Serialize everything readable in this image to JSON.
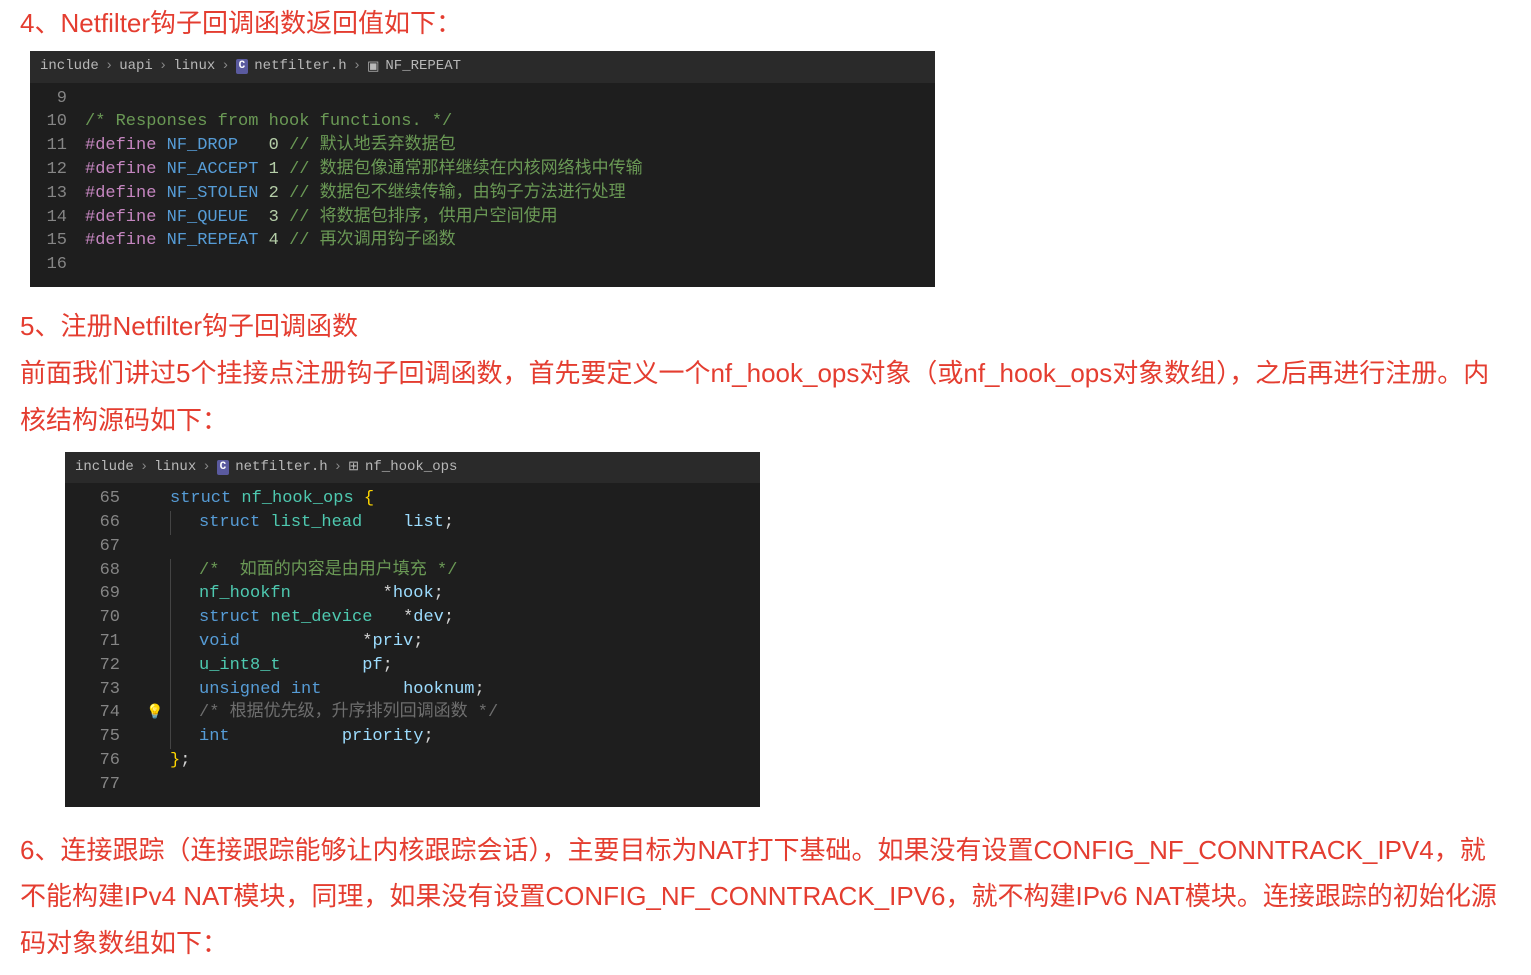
{
  "section4": {
    "title": "4、Netfilter钩子回调函数返回值如下：",
    "breadcrumb": {
      "p1": "include",
      "p2": "uapi",
      "p3": "linux",
      "file": "netfilter.h",
      "symbol": "NF_REPEAT"
    },
    "lines": [
      {
        "num": "9",
        "tokens": []
      },
      {
        "num": "10",
        "tokens": [
          {
            "t": "/* Responses from hook functions. */",
            "c": "c-comment"
          }
        ]
      },
      {
        "num": "11",
        "tokens": [
          {
            "t": "#define",
            "c": "c-keyword"
          },
          {
            "t": " ",
            "c": ""
          },
          {
            "t": "NF_DROP",
            "c": "c-macro"
          },
          {
            "t": "   ",
            "c": ""
          },
          {
            "t": "0",
            "c": "c-number"
          },
          {
            "t": " ",
            "c": ""
          },
          {
            "t": "// 默认地丢弃数据包",
            "c": "c-comment"
          }
        ]
      },
      {
        "num": "12",
        "tokens": [
          {
            "t": "#define",
            "c": "c-keyword"
          },
          {
            "t": " ",
            "c": ""
          },
          {
            "t": "NF_ACCEPT",
            "c": "c-macro"
          },
          {
            "t": " ",
            "c": ""
          },
          {
            "t": "1",
            "c": "c-number"
          },
          {
            "t": " ",
            "c": ""
          },
          {
            "t": "// 数据包像通常那样继续在内核网络栈中传输",
            "c": "c-comment"
          }
        ]
      },
      {
        "num": "13",
        "tokens": [
          {
            "t": "#define",
            "c": "c-keyword"
          },
          {
            "t": " ",
            "c": ""
          },
          {
            "t": "NF_STOLEN",
            "c": "c-macro"
          },
          {
            "t": " ",
            "c": ""
          },
          {
            "t": "2",
            "c": "c-number"
          },
          {
            "t": " ",
            "c": ""
          },
          {
            "t": "// 数据包不继续传输，由钩子方法进行处理",
            "c": "c-comment"
          }
        ]
      },
      {
        "num": "14",
        "tokens": [
          {
            "t": "#define",
            "c": "c-keyword"
          },
          {
            "t": " ",
            "c": ""
          },
          {
            "t": "NF_QUEUE",
            "c": "c-macro"
          },
          {
            "t": "  ",
            "c": ""
          },
          {
            "t": "3",
            "c": "c-number"
          },
          {
            "t": " ",
            "c": ""
          },
          {
            "t": "// 将数据包排序，供用户空间使用",
            "c": "c-comment"
          }
        ]
      },
      {
        "num": "15",
        "tokens": [
          {
            "t": "#define",
            "c": "c-keyword"
          },
          {
            "t": " ",
            "c": ""
          },
          {
            "t": "NF_REPEAT",
            "c": "c-macro"
          },
          {
            "t": " ",
            "c": ""
          },
          {
            "t": "4",
            "c": "c-number"
          },
          {
            "t": " ",
            "c": ""
          },
          {
            "t": "// 再次调用钩子函数",
            "c": "c-comment"
          }
        ]
      },
      {
        "num": "16",
        "tokens": []
      }
    ]
  },
  "section5": {
    "title": "5、注册Netfilter钩子回调函数",
    "para": "前面我们讲过5个挂接点注册钩子回调函数，首先要定义一个nf_hook_ops对象（或nf_hook_ops对象数组），之后再进行注册。内核结构源码如下：",
    "breadcrumb": {
      "p1": "include",
      "p2": "linux",
      "file": "netfilter.h",
      "symbol": "nf_hook_ops"
    },
    "lines": [
      {
        "num": "65",
        "indent": false,
        "bulb": false,
        "tokens": [
          {
            "t": "struct",
            "c": "c-struct-kw"
          },
          {
            "t": " ",
            "c": ""
          },
          {
            "t": "nf_hook_ops",
            "c": "c-type"
          },
          {
            "t": " ",
            "c": ""
          },
          {
            "t": "{",
            "c": "c-brace"
          }
        ]
      },
      {
        "num": "66",
        "indent": true,
        "bulb": false,
        "tokens": [
          {
            "t": "struct",
            "c": "c-struct-kw"
          },
          {
            "t": " ",
            "c": ""
          },
          {
            "t": "list_head",
            "c": "c-type"
          },
          {
            "t": "    ",
            "c": ""
          },
          {
            "t": "list",
            "c": "c-ident"
          },
          {
            "t": ";",
            "c": "c-punct"
          }
        ]
      },
      {
        "num": "67",
        "indent": true,
        "bulb": false,
        "tokens": []
      },
      {
        "num": "68",
        "indent": true,
        "bulb": false,
        "tokens": [
          {
            "t": "/*  如面的内容是由用户填充 */",
            "c": "c-comment"
          }
        ]
      },
      {
        "num": "69",
        "indent": true,
        "bulb": false,
        "tokens": [
          {
            "t": "nf_hookfn",
            "c": "c-type"
          },
          {
            "t": "         ",
            "c": ""
          },
          {
            "t": "*",
            "c": "c-punct"
          },
          {
            "t": "hook",
            "c": "c-ident"
          },
          {
            "t": ";",
            "c": "c-punct"
          }
        ]
      },
      {
        "num": "70",
        "indent": true,
        "bulb": false,
        "tokens": [
          {
            "t": "struct",
            "c": "c-struct-kw"
          },
          {
            "t": " ",
            "c": ""
          },
          {
            "t": "net_device",
            "c": "c-type"
          },
          {
            "t": "   ",
            "c": ""
          },
          {
            "t": "*",
            "c": "c-punct"
          },
          {
            "t": "dev",
            "c": "c-ident"
          },
          {
            "t": ";",
            "c": "c-punct"
          }
        ]
      },
      {
        "num": "71",
        "indent": true,
        "bulb": false,
        "tokens": [
          {
            "t": "void",
            "c": "c-struct-kw"
          },
          {
            "t": "            ",
            "c": ""
          },
          {
            "t": "*",
            "c": "c-punct"
          },
          {
            "t": "priv",
            "c": "c-ident"
          },
          {
            "t": ";",
            "c": "c-punct"
          }
        ]
      },
      {
        "num": "72",
        "indent": true,
        "bulb": false,
        "tokens": [
          {
            "t": "u_int8_t",
            "c": "c-type"
          },
          {
            "t": "        ",
            "c": ""
          },
          {
            "t": "pf",
            "c": "c-ident"
          },
          {
            "t": ";",
            "c": "c-punct"
          }
        ]
      },
      {
        "num": "73",
        "indent": true,
        "bulb": false,
        "tokens": [
          {
            "t": "unsigned",
            "c": "c-struct-kw"
          },
          {
            "t": " ",
            "c": ""
          },
          {
            "t": "int",
            "c": "c-struct-kw"
          },
          {
            "t": "        ",
            "c": ""
          },
          {
            "t": "hooknum",
            "c": "c-ident"
          },
          {
            "t": ";",
            "c": "c-punct"
          }
        ]
      },
      {
        "num": "74",
        "indent": true,
        "bulb": true,
        "tokens": [
          {
            "t": "/* 根据优先级，升序排列回调函数 */",
            "c": "c-dim"
          }
        ]
      },
      {
        "num": "75",
        "indent": true,
        "bulb": false,
        "tokens": [
          {
            "t": "int",
            "c": "c-struct-kw"
          },
          {
            "t": "           ",
            "c": ""
          },
          {
            "t": "priority",
            "c": "c-ident"
          },
          {
            "t": ";",
            "c": "c-punct"
          }
        ]
      },
      {
        "num": "76",
        "indent": false,
        "bulb": false,
        "tokens": [
          {
            "t": "}",
            "c": "c-brace"
          },
          {
            "t": ";",
            "c": "c-punct"
          }
        ]
      },
      {
        "num": "77",
        "indent": false,
        "bulb": false,
        "tokens": []
      }
    ]
  },
  "section6": {
    "para": "6、连接跟踪（连接跟踪能够让内核跟踪会话），主要目标为NAT打下基础。如果没有设置CONFIG_NF_CONNTRACK_IPV4，就不能构建IPv4 NAT模块，同理，如果没有设置CONFIG_NF_CONNTRACK_IPV6，就不构建IPv6 NAT模块。连接跟踪的初始化源码对象数组如下："
  }
}
